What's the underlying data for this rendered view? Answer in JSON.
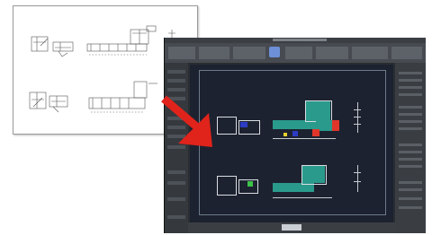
{
  "scene": {
    "description_none": ""
  },
  "cad_app": {
    "accent_color": "#2a9a8c",
    "highlight_colors": [
      "#2c3cc4",
      "#e0362a",
      "#e8d12c",
      "#3cc24a"
    ]
  },
  "arrow": {
    "color": "#e0231b",
    "icon": "arrow-right-down-icon"
  }
}
